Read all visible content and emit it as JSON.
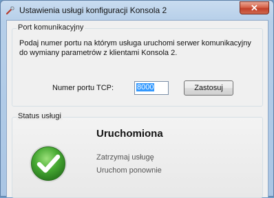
{
  "window": {
    "title": "Ustawienia usługi konfiguracji Konsola 2",
    "close_icon": "close-icon",
    "app_icon": "tools-icon"
  },
  "port_group": {
    "label": "Port komunikacyjny",
    "description_line1": "Podaj numer portu na którym usługa uruchomi serwer komunikacyjny",
    "description_line2": "do wymiany parametrów z klientami Konsola 2.",
    "port_label": "Numer portu TCP:",
    "port_value": "8000",
    "apply_label": "Zastosuj"
  },
  "status_group": {
    "label": "Status usługi",
    "status_text": "Uruchomiona",
    "status_icon": "checkmark-icon",
    "stop_link": "Zatrzymaj usługę",
    "restart_link": "Uruchom ponownie"
  },
  "colors": {
    "accent": "#3399ff",
    "success": "#3a9a2c",
    "close": "#c1402a"
  }
}
